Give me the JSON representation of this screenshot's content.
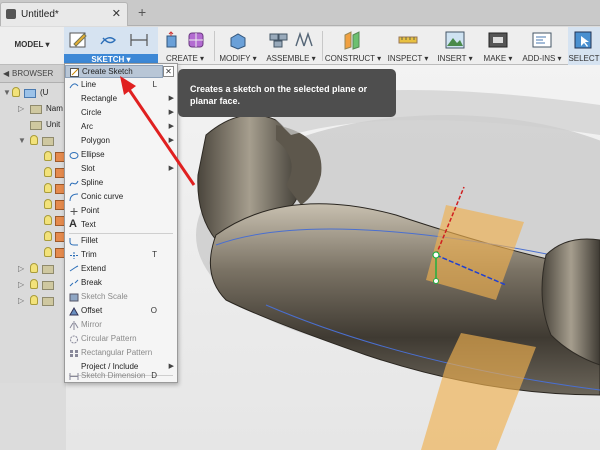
{
  "tab": {
    "title": "Untitled*",
    "close": "✕",
    "add": "+"
  },
  "toolbar": {
    "model": "MODEL ▾",
    "sketch": "SKETCH ▾",
    "create": "CREATE ▾",
    "modify": "MODIFY ▾",
    "assemble": "ASSEMBLE ▾",
    "construct": "CONSTRUCT ▾",
    "inspect": "INSPECT ▾",
    "insert": "INSERT ▾",
    "make": "MAKE ▾",
    "addins": "ADD-INS ▾",
    "select": "SELECT"
  },
  "browser": {
    "header": "BROWSER",
    "items": [
      {
        "label": "(U"
      },
      {
        "label": "Nam"
      },
      {
        "label": "Unit"
      },
      {
        "label": ""
      }
    ]
  },
  "menu": {
    "close": "✕",
    "items": [
      {
        "label": "Create Sketch",
        "shortcut": "",
        "submenu": false,
        "disabled": false
      },
      {
        "label": "Line",
        "shortcut": "L",
        "submenu": false,
        "disabled": false
      },
      {
        "label": "Rectangle",
        "shortcut": "",
        "submenu": true,
        "disabled": false
      },
      {
        "label": "Circle",
        "shortcut": "",
        "submenu": true,
        "disabled": false
      },
      {
        "label": "Arc",
        "shortcut": "",
        "submenu": true,
        "disabled": false
      },
      {
        "label": "Polygon",
        "shortcut": "",
        "submenu": true,
        "disabled": false
      },
      {
        "label": "Ellipse",
        "shortcut": "",
        "submenu": false,
        "disabled": false
      },
      {
        "label": "Slot",
        "shortcut": "",
        "submenu": true,
        "disabled": false
      },
      {
        "label": "Spline",
        "shortcut": "",
        "submenu": false,
        "disabled": false
      },
      {
        "label": "Conic curve",
        "shortcut": "",
        "submenu": false,
        "disabled": false
      },
      {
        "label": "Point",
        "shortcut": "",
        "submenu": false,
        "disabled": false
      },
      {
        "label": "Text",
        "shortcut": "",
        "submenu": false,
        "disabled": false
      },
      {
        "label": "Fillet",
        "shortcut": "",
        "submenu": false,
        "disabled": false
      },
      {
        "label": "Trim",
        "shortcut": "T",
        "submenu": false,
        "disabled": false
      },
      {
        "label": "Extend",
        "shortcut": "",
        "submenu": false,
        "disabled": false
      },
      {
        "label": "Break",
        "shortcut": "",
        "submenu": false,
        "disabled": false
      },
      {
        "label": "Sketch Scale",
        "shortcut": "",
        "submenu": false,
        "disabled": true
      },
      {
        "label": "Offset",
        "shortcut": "O",
        "submenu": false,
        "disabled": false
      },
      {
        "label": "Mirror",
        "shortcut": "",
        "submenu": false,
        "disabled": true
      },
      {
        "label": "Circular Pattern",
        "shortcut": "",
        "submenu": false,
        "disabled": true
      },
      {
        "label": "Rectangular Pattern",
        "shortcut": "",
        "submenu": false,
        "disabled": true
      },
      {
        "label": "Project / Include",
        "shortcut": "",
        "submenu": true,
        "disabled": false
      },
      {
        "label": "Sketch Dimension",
        "shortcut": "D",
        "submenu": false,
        "disabled": true
      }
    ]
  },
  "tooltip": {
    "text": "Creates a sketch on the selected plane or planar face."
  },
  "colors": {
    "accent": "#3d88d6",
    "arrow": "#e02020",
    "plane": "#f0b050"
  }
}
